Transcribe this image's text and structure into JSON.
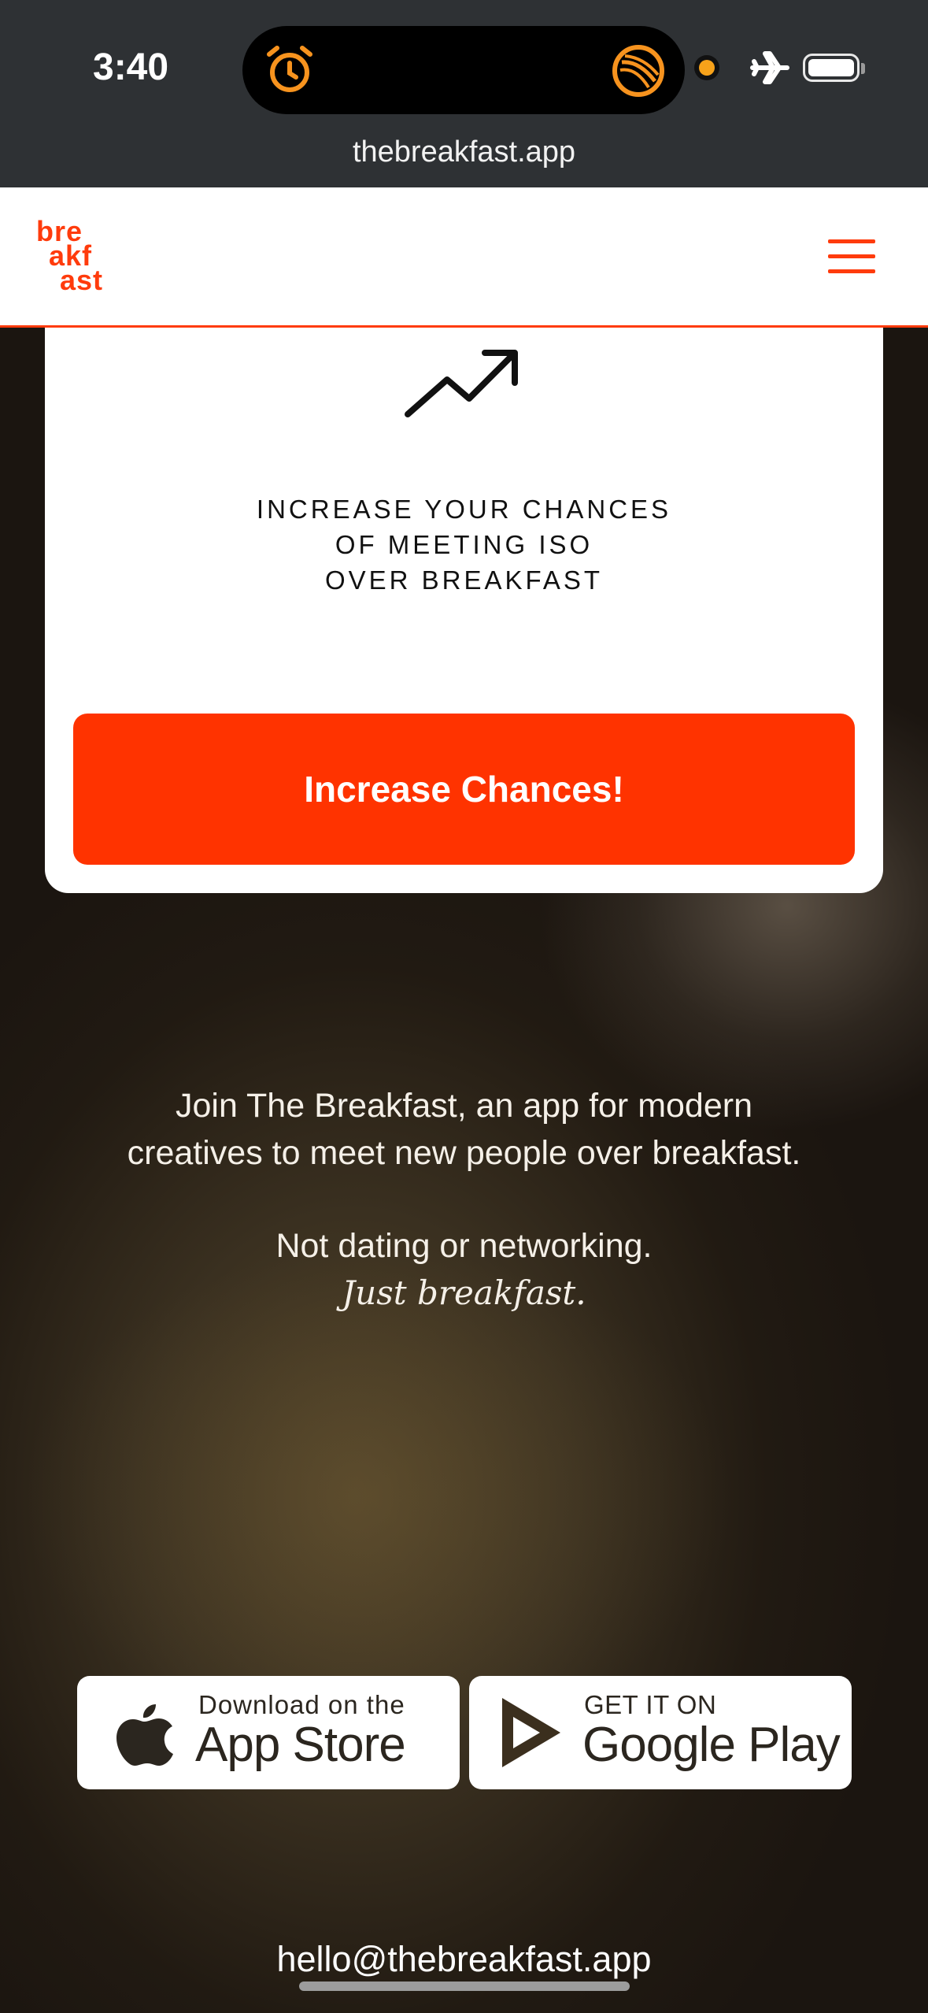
{
  "status_bar": {
    "time": "3:40",
    "url": "thebreakfast.app",
    "icons": [
      "alarm-icon",
      "live-activity-icon",
      "recording-dot-icon",
      "airplane-mode-icon",
      "battery-icon"
    ]
  },
  "header": {
    "logo_lines": [
      "bre",
      "akf",
      "ast"
    ],
    "menu_icon": "hamburger-menu-icon"
  },
  "card": {
    "icon": "trending-up-icon",
    "text_lines": [
      "INCREASE YOUR CHANCES",
      "OF MEETING ISO",
      "OVER BREAKFAST"
    ],
    "button_label": "Increase Chances!"
  },
  "blurb": {
    "line1": "Join The Breakfast, an app for modern",
    "line2": "creatives to meet new people over breakfast.",
    "line3": "Not dating or networking.",
    "line4": "Just breakfast."
  },
  "badges": {
    "app_store": {
      "small": "Download on the",
      "big": "App Store"
    },
    "google_play": {
      "small": "GET IT ON",
      "big": "Google Play"
    }
  },
  "footer": {
    "email": "hello@thebreakfast.app"
  },
  "colors": {
    "accent": "#ff3300",
    "status_bar": "#2e3134",
    "alarm": "#f7931e"
  }
}
